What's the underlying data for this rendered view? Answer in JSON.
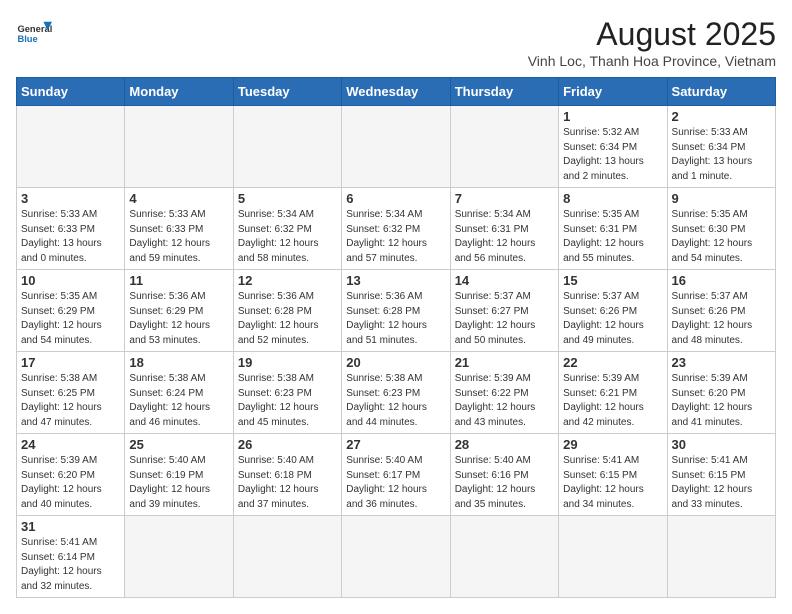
{
  "header": {
    "logo_general": "General",
    "logo_blue": "Blue",
    "month_year": "August 2025",
    "location": "Vinh Loc, Thanh Hoa Province, Vietnam"
  },
  "days_of_week": [
    "Sunday",
    "Monday",
    "Tuesday",
    "Wednesday",
    "Thursday",
    "Friday",
    "Saturday"
  ],
  "weeks": [
    [
      {
        "day": "",
        "info": ""
      },
      {
        "day": "",
        "info": ""
      },
      {
        "day": "",
        "info": ""
      },
      {
        "day": "",
        "info": ""
      },
      {
        "day": "",
        "info": ""
      },
      {
        "day": "1",
        "info": "Sunrise: 5:32 AM\nSunset: 6:34 PM\nDaylight: 13 hours\nand 2 minutes."
      },
      {
        "day": "2",
        "info": "Sunrise: 5:33 AM\nSunset: 6:34 PM\nDaylight: 13 hours\nand 1 minute."
      }
    ],
    [
      {
        "day": "3",
        "info": "Sunrise: 5:33 AM\nSunset: 6:33 PM\nDaylight: 13 hours\nand 0 minutes."
      },
      {
        "day": "4",
        "info": "Sunrise: 5:33 AM\nSunset: 6:33 PM\nDaylight: 12 hours\nand 59 minutes."
      },
      {
        "day": "5",
        "info": "Sunrise: 5:34 AM\nSunset: 6:32 PM\nDaylight: 12 hours\nand 58 minutes."
      },
      {
        "day": "6",
        "info": "Sunrise: 5:34 AM\nSunset: 6:32 PM\nDaylight: 12 hours\nand 57 minutes."
      },
      {
        "day": "7",
        "info": "Sunrise: 5:34 AM\nSunset: 6:31 PM\nDaylight: 12 hours\nand 56 minutes."
      },
      {
        "day": "8",
        "info": "Sunrise: 5:35 AM\nSunset: 6:31 PM\nDaylight: 12 hours\nand 55 minutes."
      },
      {
        "day": "9",
        "info": "Sunrise: 5:35 AM\nSunset: 6:30 PM\nDaylight: 12 hours\nand 54 minutes."
      }
    ],
    [
      {
        "day": "10",
        "info": "Sunrise: 5:35 AM\nSunset: 6:29 PM\nDaylight: 12 hours\nand 54 minutes."
      },
      {
        "day": "11",
        "info": "Sunrise: 5:36 AM\nSunset: 6:29 PM\nDaylight: 12 hours\nand 53 minutes."
      },
      {
        "day": "12",
        "info": "Sunrise: 5:36 AM\nSunset: 6:28 PM\nDaylight: 12 hours\nand 52 minutes."
      },
      {
        "day": "13",
        "info": "Sunrise: 5:36 AM\nSunset: 6:28 PM\nDaylight: 12 hours\nand 51 minutes."
      },
      {
        "day": "14",
        "info": "Sunrise: 5:37 AM\nSunset: 6:27 PM\nDaylight: 12 hours\nand 50 minutes."
      },
      {
        "day": "15",
        "info": "Sunrise: 5:37 AM\nSunset: 6:26 PM\nDaylight: 12 hours\nand 49 minutes."
      },
      {
        "day": "16",
        "info": "Sunrise: 5:37 AM\nSunset: 6:26 PM\nDaylight: 12 hours\nand 48 minutes."
      }
    ],
    [
      {
        "day": "17",
        "info": "Sunrise: 5:38 AM\nSunset: 6:25 PM\nDaylight: 12 hours\nand 47 minutes."
      },
      {
        "day": "18",
        "info": "Sunrise: 5:38 AM\nSunset: 6:24 PM\nDaylight: 12 hours\nand 46 minutes."
      },
      {
        "day": "19",
        "info": "Sunrise: 5:38 AM\nSunset: 6:23 PM\nDaylight: 12 hours\nand 45 minutes."
      },
      {
        "day": "20",
        "info": "Sunrise: 5:38 AM\nSunset: 6:23 PM\nDaylight: 12 hours\nand 44 minutes."
      },
      {
        "day": "21",
        "info": "Sunrise: 5:39 AM\nSunset: 6:22 PM\nDaylight: 12 hours\nand 43 minutes."
      },
      {
        "day": "22",
        "info": "Sunrise: 5:39 AM\nSunset: 6:21 PM\nDaylight: 12 hours\nand 42 minutes."
      },
      {
        "day": "23",
        "info": "Sunrise: 5:39 AM\nSunset: 6:20 PM\nDaylight: 12 hours\nand 41 minutes."
      }
    ],
    [
      {
        "day": "24",
        "info": "Sunrise: 5:39 AM\nSunset: 6:20 PM\nDaylight: 12 hours\nand 40 minutes."
      },
      {
        "day": "25",
        "info": "Sunrise: 5:40 AM\nSunset: 6:19 PM\nDaylight: 12 hours\nand 39 minutes."
      },
      {
        "day": "26",
        "info": "Sunrise: 5:40 AM\nSunset: 6:18 PM\nDaylight: 12 hours\nand 37 minutes."
      },
      {
        "day": "27",
        "info": "Sunrise: 5:40 AM\nSunset: 6:17 PM\nDaylight: 12 hours\nand 36 minutes."
      },
      {
        "day": "28",
        "info": "Sunrise: 5:40 AM\nSunset: 6:16 PM\nDaylight: 12 hours\nand 35 minutes."
      },
      {
        "day": "29",
        "info": "Sunrise: 5:41 AM\nSunset: 6:15 PM\nDaylight: 12 hours\nand 34 minutes."
      },
      {
        "day": "30",
        "info": "Sunrise: 5:41 AM\nSunset: 6:15 PM\nDaylight: 12 hours\nand 33 minutes."
      }
    ],
    [
      {
        "day": "31",
        "info": "Sunrise: 5:41 AM\nSunset: 6:14 PM\nDaylight: 12 hours\nand 32 minutes."
      },
      {
        "day": "",
        "info": ""
      },
      {
        "day": "",
        "info": ""
      },
      {
        "day": "",
        "info": ""
      },
      {
        "day": "",
        "info": ""
      },
      {
        "day": "",
        "info": ""
      },
      {
        "day": "",
        "info": ""
      }
    ]
  ]
}
